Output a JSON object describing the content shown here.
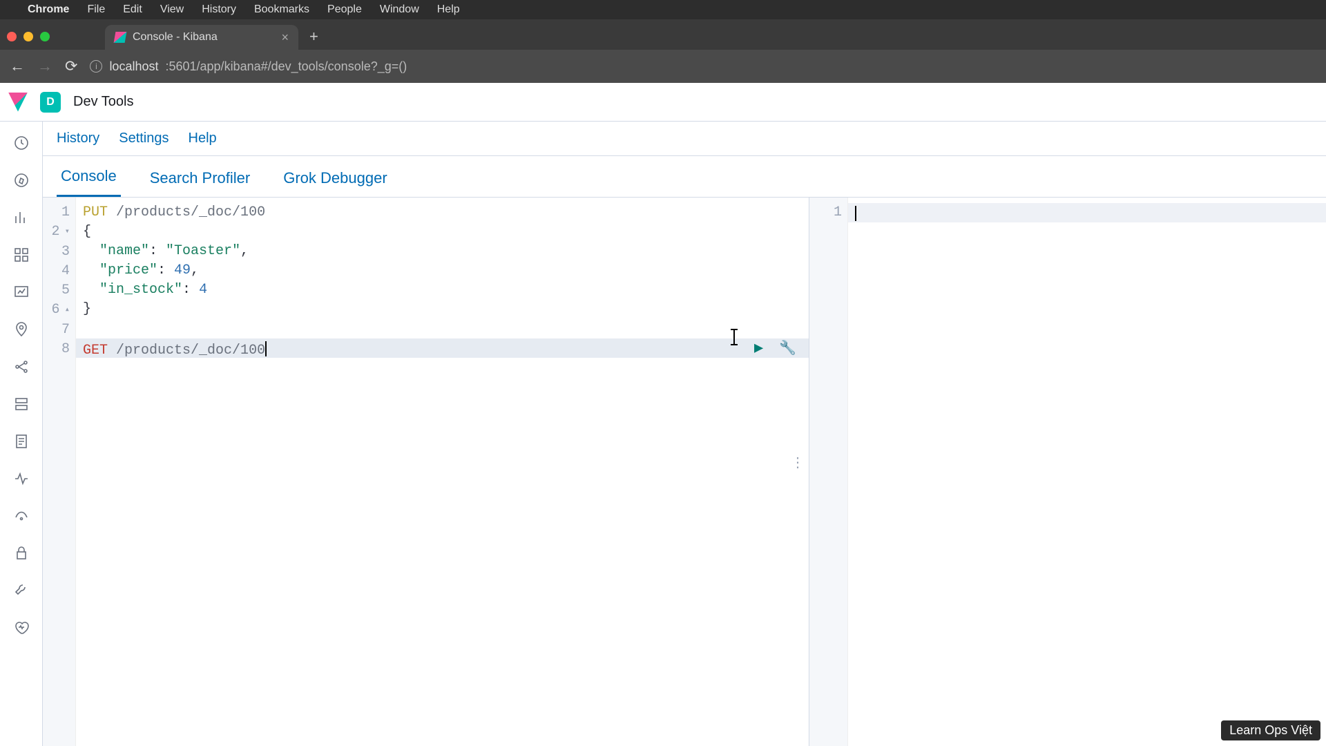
{
  "macos_menu": {
    "app": "Chrome",
    "items": [
      "File",
      "Edit",
      "View",
      "History",
      "Bookmarks",
      "People",
      "Window",
      "Help"
    ]
  },
  "browser": {
    "tab_title": "Console - Kibana",
    "url_host": "localhost",
    "url_path": ":5601/app/kibana#/dev_tools/console?_g=()"
  },
  "kibana": {
    "space_letter": "D",
    "page_title": "Dev Tools",
    "sub_links": [
      "History",
      "Settings",
      "Help"
    ],
    "tabs": [
      "Console",
      "Search Profiler",
      "Grok Debugger"
    ],
    "active_tab": "Console"
  },
  "editor": {
    "gutter": [
      "1",
      "2",
      "3",
      "4",
      "5",
      "6",
      "7",
      "8"
    ],
    "line1_method": "PUT",
    "line1_path": "/products/_doc/100",
    "line2": "{",
    "line3_key": "\"name\"",
    "line3_val": "\"Toaster\"",
    "line4_key": "\"price\"",
    "line4_val": "49",
    "line5_key": "\"in_stock\"",
    "line5_val": "4",
    "line6": "}",
    "line8_method": "GET",
    "line8_path": "/products/_doc/100"
  },
  "output": {
    "gutter": [
      "1"
    ]
  },
  "watermark": "Learn Ops Việt"
}
